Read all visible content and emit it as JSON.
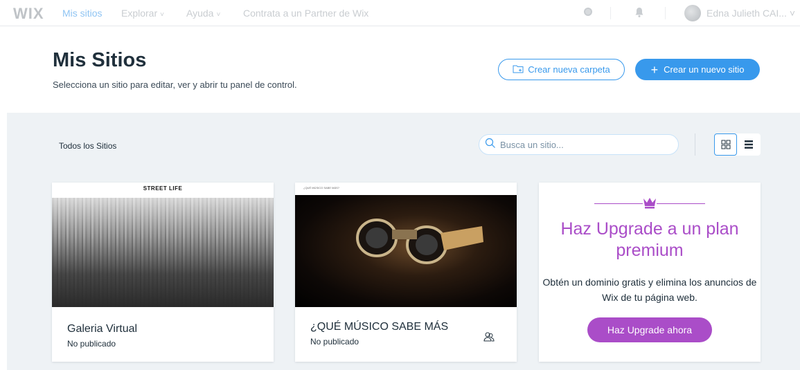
{
  "topbar": {
    "logo": "WIX",
    "nav": [
      {
        "label": "Mis sitios",
        "active": true
      },
      {
        "label": "Explorar",
        "chevron": "˅"
      },
      {
        "label": "Ayuda",
        "chevron": "˅"
      },
      {
        "label": "Contrata a un Partner de Wix"
      }
    ],
    "icons": [
      "search-icon",
      "bell-icon"
    ],
    "user_name": "Edna Julieth CAI... ˅"
  },
  "header": {
    "title": "Mis Sitios",
    "subtitle": "Selecciona un sitio para editar, ver y abrir tu panel de control.",
    "create_folder_label": "Crear nueva carpeta",
    "create_site_label": "Crear un nuevo sitio",
    "plus": "+"
  },
  "toolbar": {
    "filter_label": "Todos los Sitios",
    "search_placeholder": "Busca un sitio...",
    "view_modes": [
      "grid-view-icon",
      "list-view-icon"
    ],
    "active_view": "grid"
  },
  "sites": [
    {
      "name": "Galeria Virtual",
      "status": "No publicado",
      "thumb_title": "STREET LIFE"
    },
    {
      "name": "¿QUÉ MÚSICO SABE MÁS",
      "status": "No publicado",
      "thumb_title": "¿QUÉ MÚSICO SABE MÁS?",
      "collab_icon": "collaborators-icon"
    }
  ],
  "upgrade": {
    "icon": "crown-icon",
    "title": "Haz Upgrade a un plan premium",
    "description": "Obtén un dominio gratis y elimina los anuncios de Wix de tu página web.",
    "button_label": "Haz Upgrade ahora"
  },
  "colors": {
    "accent_blue": "#3899ec",
    "premium_purple": "#aa4dc8",
    "page_bg": "#eef2f5",
    "text_dark": "#20303c"
  }
}
